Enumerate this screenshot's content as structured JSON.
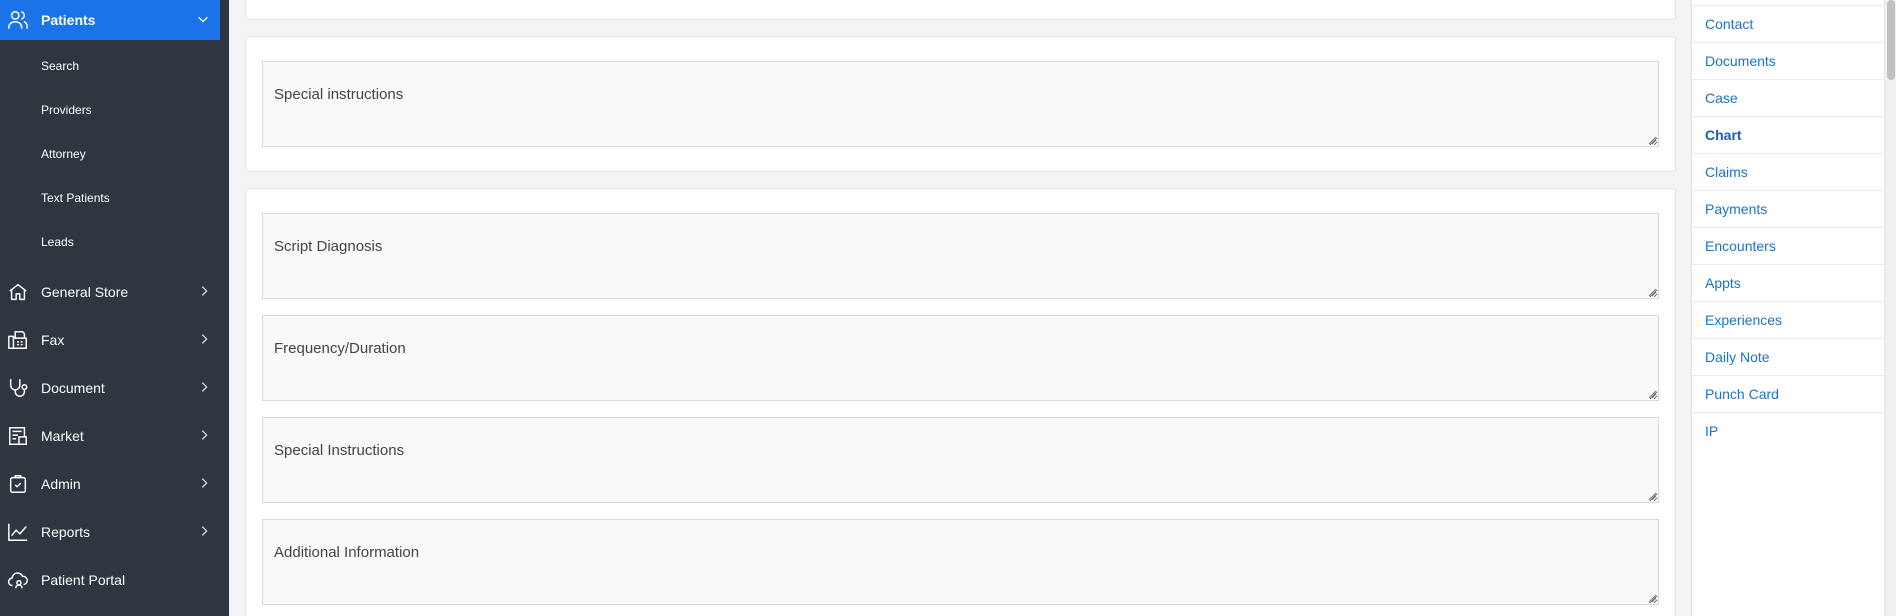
{
  "sidebar": {
    "patients": {
      "label": "Patients",
      "icon": "users-icon"
    },
    "sub_items": [
      {
        "label": "Search"
      },
      {
        "label": "Providers"
      },
      {
        "label": "Attorney"
      },
      {
        "label": "Text Patients"
      },
      {
        "label": "Leads"
      }
    ],
    "menu": [
      {
        "label": "General Store",
        "icon": "home-icon"
      },
      {
        "label": "Fax",
        "icon": "fax-icon"
      },
      {
        "label": "Document",
        "icon": "stethoscope-icon"
      },
      {
        "label": "Market",
        "icon": "market-icon"
      },
      {
        "label": "Admin",
        "icon": "clipboard-icon"
      },
      {
        "label": "Reports",
        "icon": "chart-line-icon"
      },
      {
        "label": "Patient Portal",
        "icon": "cloud-user-icon"
      }
    ],
    "colors": {
      "background": "#2e363f",
      "active": "#1a73e8"
    }
  },
  "main": {
    "special_instructions_card": {
      "field": {
        "placeholder": "Special instructions"
      }
    },
    "script_card": {
      "fields": [
        {
          "placeholder": "Script Diagnosis"
        },
        {
          "placeholder": "Frequency/Duration"
        },
        {
          "placeholder": "Special Instructions"
        },
        {
          "placeholder": "Additional Information"
        }
      ]
    }
  },
  "right_tabs": {
    "items": [
      {
        "label": "Contact"
      },
      {
        "label": "Documents"
      },
      {
        "label": "Case"
      },
      {
        "label": "Chart",
        "active": true
      },
      {
        "label": "Claims"
      },
      {
        "label": "Payments"
      },
      {
        "label": "Encounters"
      },
      {
        "label": "Appts"
      },
      {
        "label": "Experiences"
      },
      {
        "label": "Daily Note"
      },
      {
        "label": "Punch Card"
      },
      {
        "label": "IP"
      }
    ],
    "link_color": "#1e73be"
  }
}
